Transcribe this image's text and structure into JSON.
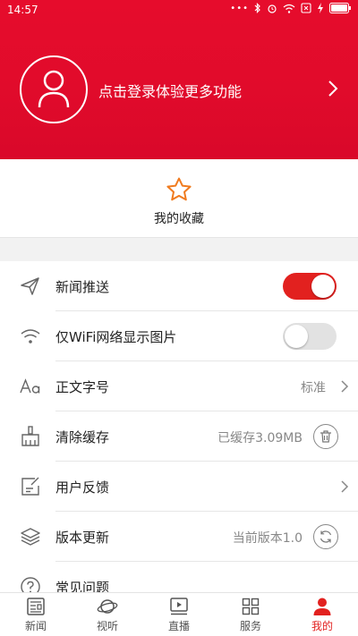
{
  "status_bar": {
    "time": "14:57",
    "dots": "•••",
    "battery": ""
  },
  "header": {
    "login_prompt": "点击登录体验更多功能",
    "accent_color": "#e60c2c"
  },
  "favorites": {
    "label": "我的收藏",
    "icon": "star-icon"
  },
  "settings": [
    {
      "label": "新闻推送",
      "type": "toggle",
      "on": true,
      "icon": "send-icon"
    },
    {
      "label": "仅WiFi网络显示图片",
      "type": "toggle",
      "on": false,
      "icon": "wifi-icon"
    },
    {
      "label": "正文字号",
      "type": "value",
      "value": "标准",
      "icon": "font-size-icon"
    },
    {
      "label": "清除缓存",
      "type": "action",
      "value": "已缓存3.09MB",
      "icon": "broom-icon"
    },
    {
      "label": "用户反馈",
      "type": "link",
      "icon": "feedback-icon"
    },
    {
      "label": "版本更新",
      "type": "action",
      "value": "当前版本1.0",
      "icon": "layers-icon"
    },
    {
      "label": "常见问题",
      "type": "link",
      "icon": "question-icon"
    }
  ],
  "bottom_nav": [
    {
      "label": "新闻",
      "icon": "news-icon",
      "active": false
    },
    {
      "label": "视听",
      "icon": "planet-icon",
      "active": false
    },
    {
      "label": "直播",
      "icon": "live-icon",
      "active": false
    },
    {
      "label": "服务",
      "icon": "grid-icon",
      "active": false
    },
    {
      "label": "我的",
      "icon": "user-icon",
      "active": true
    }
  ]
}
